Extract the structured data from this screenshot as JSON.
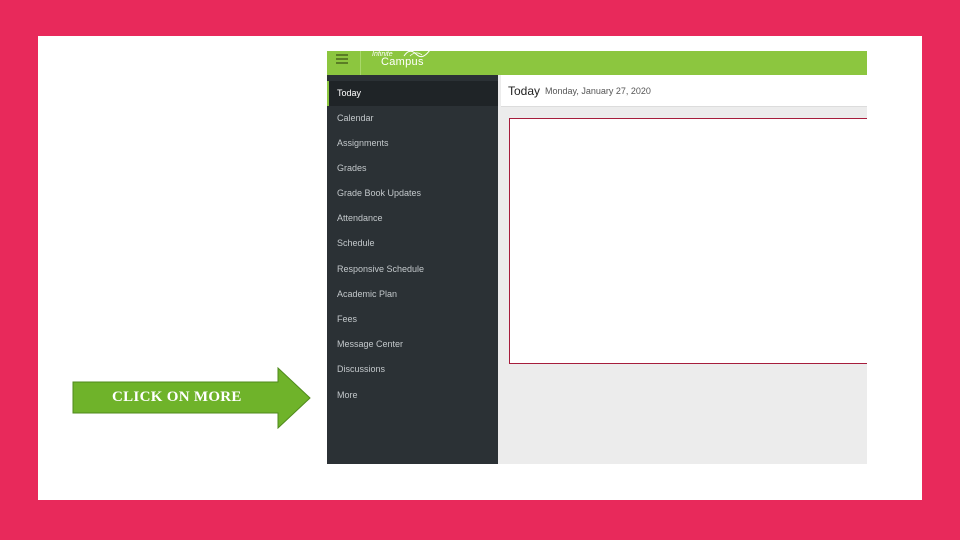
{
  "app": {
    "logo_top": "Infinite",
    "logo_main": "Campus"
  },
  "sidebar": {
    "items": [
      {
        "label": "Today",
        "active": true
      },
      {
        "label": "Calendar"
      },
      {
        "label": "Assignments"
      },
      {
        "label": "Grades"
      },
      {
        "label": "Grade Book Updates"
      },
      {
        "label": "Attendance"
      },
      {
        "label": "Schedule"
      },
      {
        "label": "Responsive Schedule"
      },
      {
        "label": "Academic Plan"
      },
      {
        "label": "Fees"
      },
      {
        "label": "Message Center"
      },
      {
        "label": "Discussions"
      },
      {
        "label": "More"
      }
    ]
  },
  "header": {
    "title": "Today",
    "date": "Monday, January 27, 2020"
  },
  "callout": {
    "label": "CLICK ON MORE"
  },
  "colors": {
    "slide_border": "#e8295b",
    "brand_green": "#8cc63f",
    "sidebar_bg": "#2b3135",
    "highlight_box": "#a61d3c",
    "arrow_green": "#6fb32a"
  }
}
